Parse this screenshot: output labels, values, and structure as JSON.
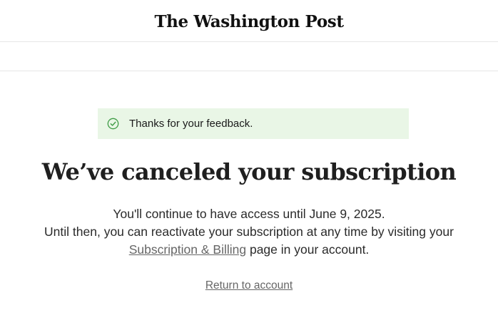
{
  "header": {
    "logo_text": "The Washington Post"
  },
  "feedback_banner": {
    "icon": "check-circle-icon",
    "message": "Thanks for your feedback.",
    "background_color": "#e9f6e6",
    "icon_color": "#3f9c46"
  },
  "main": {
    "headline": "We’ve canceled your subscription",
    "access_line": "You'll continue to have access until June 9, 2025.",
    "reactivate_line_prefix": "Until then, you can reactivate your subscription at any time by visiting your ",
    "billing_link_label": "Subscription & Billing",
    "reactivate_line_suffix": " page in your account.",
    "return_link_label": "Return to account"
  }
}
